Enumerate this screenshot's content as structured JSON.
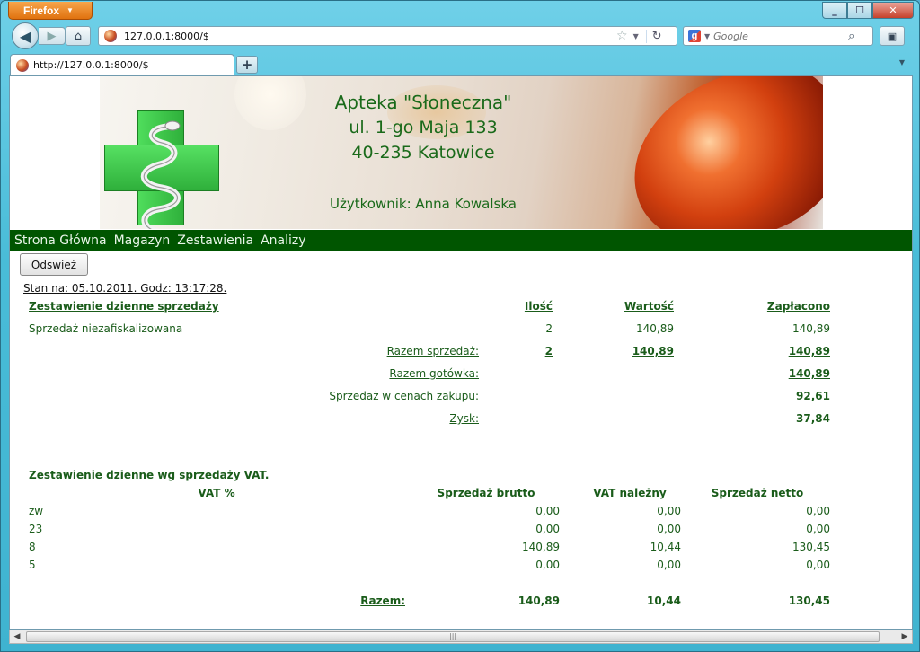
{
  "browser": {
    "app_button": "Firefox",
    "url": "127.0.0.1:8000/$",
    "search_placeholder": "Google",
    "tab_title": "http://127.0.0.1:8000/$",
    "new_tab": "+"
  },
  "banner": {
    "name": "Apteka \"Słoneczna\"",
    "street": "ul. 1-go Maja 133",
    "city": "40-235 Katowice",
    "user": "Użytkownik: Anna Kowalska"
  },
  "menu": [
    "Strona Główna",
    "Magazyn",
    "Zestawienia",
    "Analizy"
  ],
  "refresh_label": "Odswież",
  "timestamp": "Stan na: 05.10.2011. Godz: 13:17:28.",
  "sales": {
    "title": "Zestawienie dzienne sprzedaży",
    "headers": {
      "qty": "Ilość",
      "value": "Wartość",
      "paid": "Zapłacono"
    },
    "row": {
      "label": "Sprzedaż niezafiskalizowana",
      "qty": "2",
      "value": "140,89",
      "paid": "140,89"
    },
    "total_sales": {
      "label": "Razem sprzedaż:",
      "qty": "2",
      "value": "140,89",
      "paid": "140,89"
    },
    "total_cash": {
      "label": "Razem gotówka:",
      "paid": "140,89"
    },
    "purchase_price": {
      "label": "Sprzedaż w cenach zakupu:",
      "paid": "92,61"
    },
    "profit": {
      "label": "Zysk:",
      "paid": "37,84"
    }
  },
  "vat": {
    "title": "Zestawienie dzienne wg sprzedaży VAT.",
    "headers": {
      "rate": "VAT %",
      "gross": "Sprzedaż brutto",
      "tax": "VAT należny",
      "net": "Sprzedaż netto"
    },
    "rows": [
      {
        "rate": "zw",
        "gross": "0,00",
        "tax": "0,00",
        "net": "0,00"
      },
      {
        "rate": "23",
        "gross": "0,00",
        "tax": "0,00",
        "net": "0,00"
      },
      {
        "rate": "8",
        "gross": "140,89",
        "tax": "10,44",
        "net": "130,45"
      },
      {
        "rate": "5",
        "gross": "0,00",
        "tax": "0,00",
        "net": "0,00"
      }
    ],
    "total": {
      "label": "Razem:",
      "gross": "140,89",
      "tax": "10,44",
      "net": "130,45"
    }
  },
  "colors": {
    "menu_bg": "#005500",
    "text_green": "#1a5c1a",
    "banner_text": "#1a6a1a"
  }
}
